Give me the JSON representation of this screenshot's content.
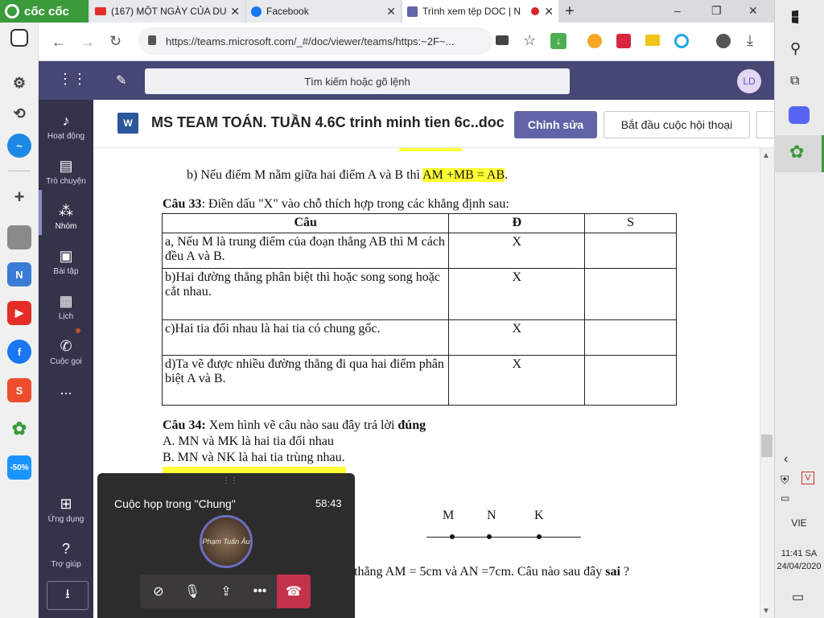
{
  "browser": {
    "brand": "cốc cốc",
    "tabs": [
      {
        "title": "(167) MỘT NGÀY CỦA DU"
      },
      {
        "title": "Facebook"
      },
      {
        "title": "Trình xem tệp DOC | N"
      }
    ],
    "new_tab": "+",
    "url": "https://teams.microsoft.com/_#/doc/viewer/teams/https:~2F~..."
  },
  "window_controls": {
    "min": "–",
    "max": "❐",
    "close": "✕"
  },
  "teams": {
    "search_placeholder": "Tìm kiếm hoặc gõ lệnh",
    "avatar": "LD",
    "rail": [
      {
        "label": "Hoạt động",
        "icon": "bell-icon"
      },
      {
        "label": "Trò chuyện",
        "icon": "chat-icon"
      },
      {
        "label": "Nhóm",
        "icon": "teams-icon"
      },
      {
        "label": "Bài tập",
        "icon": "assignment-icon"
      },
      {
        "label": "Lịch",
        "icon": "calendar-icon"
      },
      {
        "label": "Cuộc gọi",
        "icon": "phone-icon"
      },
      {
        "label": "...",
        "icon": "more-icon"
      },
      {
        "label": "Ứng dụng",
        "icon": "apps-icon"
      },
      {
        "label": "Trợ giúp",
        "icon": "help-icon"
      }
    ],
    "doc_title": "MS TEAM TOÁN. TUẦN 4.6C trinh minh tien 6c..doc",
    "edit_button": "Chỉnh sửa",
    "conversation_button": "Bắt đầu cuộc hội thoại"
  },
  "document": {
    "line_b_prefix": "b) Nếu điểm M nằm giữa hai điểm A và B thì ",
    "line_b_highlight": "AM +MB = AB",
    "line_b_suffix": ".",
    "q33_label": "Câu 33",
    "q33_text": ": Điền dấu \"X\" vào chỗ thích hợp trong các khẳng định sau:",
    "table": {
      "headers": [
        "Câu",
        "Đ",
        "S"
      ],
      "rows": [
        {
          "text": "a, Nếu M là trung điểm của đoạn thẳng AB thì M cách đều A và B.",
          "d": "X",
          "s": ""
        },
        {
          "text": "b)Hai đường thẳng phân biệt thì hoặc song song hoặc cắt nhau.",
          "d": "X",
          "s": ""
        },
        {
          "text": "c)Hai tia đối nhau là hai tia có chung gốc.",
          "d": "X",
          "s": ""
        },
        {
          "text": "d)Ta vẽ được nhiều đường thẳng đi qua hai điểm phân biệt A và B.",
          "d": "X",
          "s": ""
        }
      ]
    },
    "q34_label": "Câu 34:",
    "q34_text": " Xem hình vẽ câu nào sau đây trả lời ",
    "q34_emph": "đúng",
    "q34_a": "A. MN và MK là hai tia đối nhau",
    "q34_b": "B. MN và NK  là hai tia trùng nhau.",
    "figure_points": [
      "M",
      "N",
      "K"
    ],
    "next_line_prefix": "thẳng AM = 5cm và AN =7cm. Câu nào sau đây ",
    "next_line_emph": "sai",
    "next_line_suffix": " ?"
  },
  "call": {
    "title": "Cuộc họp trong \"Chung\"",
    "time": "58:43",
    "avatar_text": "Phạm Tuấn Âu"
  },
  "taskbar": {
    "lang": "VIE",
    "time": "11:41 SA",
    "date": "24/04/2020"
  },
  "colors": {
    "teams_purple": "#464775",
    "rail": "#33344a",
    "accent": "#6264a7",
    "highlight": "#ffff33",
    "hangup": "#c4314b"
  }
}
